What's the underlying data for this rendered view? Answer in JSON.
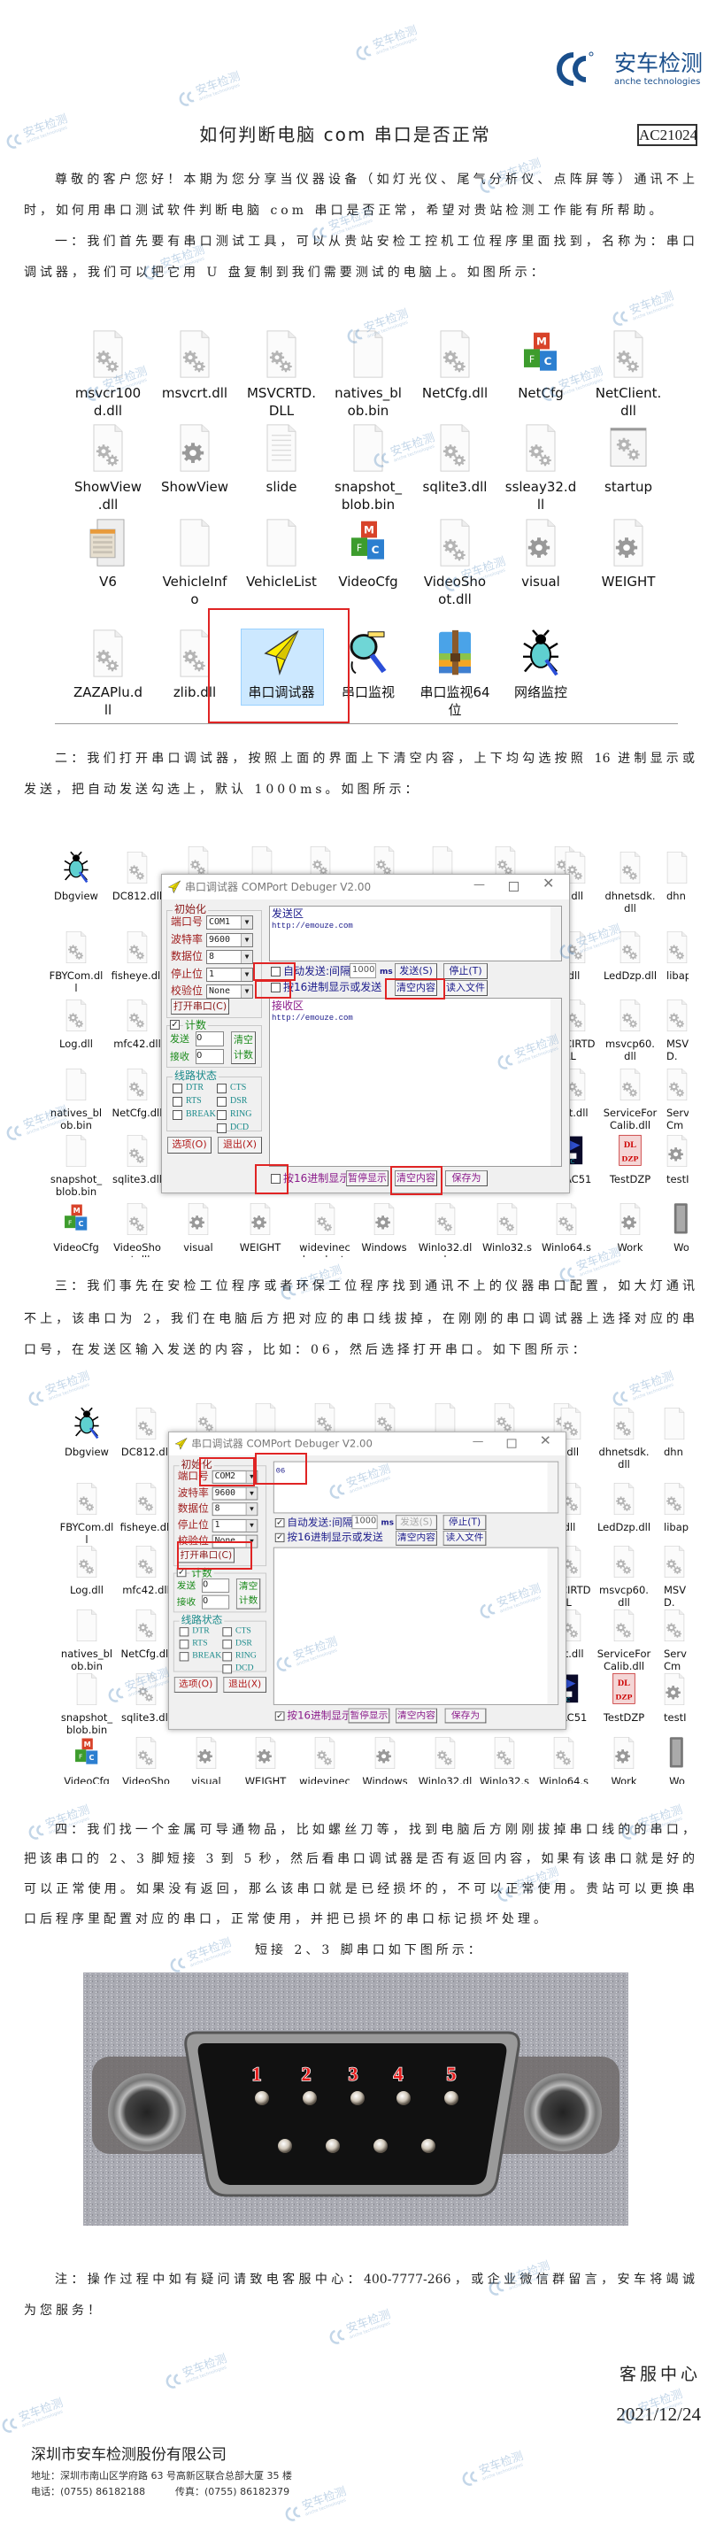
{
  "brand": {
    "name": "安车检测",
    "sub": "anche technologies",
    "color": "#1a4f8c"
  },
  "watermark": {
    "text": "安车检测",
    "sub": "anche technologies"
  },
  "title": "如何判断电脑 com 串口是否正常",
  "doc_code": "AC21024",
  "para1": [
    "尊敬的客户您好！本期为您分享当仪器设备（如灯光仪、尾气分析仪、点阵屏等）通讯不上",
    "时，如何用串口测试软件判断电脑 com 串口是否正常，希望对贵站检测工作能有所帮助。",
    "一：我们首先要有串口测试工具，可以从贵站安检工控机工位程序里面找到，名称为：串口",
    "调试器，我们可以把它用 U 盘复制到我们需要测试的电脑上。如图所示："
  ],
  "para2": [
    "二：我们打开串口调试器，按照上面的界面上下清空内容，上下均勾选按照 16 进制显示或",
    "发送，把自动发送勾选上，默认 1000ms。如图所示："
  ],
  "para3": [
    "三：我们事先在安检工位程序或者环保工位程序找到通讯不上的仪器串口配置，如大灯通讯",
    "不上，该串口为 2，我们在电脑后方把对应的串口线拔掉，在刚刚的串口调试器上选择对应的串",
    "口号，在发送区输入发送的内容，比如：06，然后选择打开串口。如下图所示："
  ],
  "para4": [
    "四：我们找一个金属可导通物品，比如螺丝刀等，找到电脑后方刚刚拔掉串口线的的串口，",
    "把该串口的 2、3 脚短接 3 到 5 秒，然后看串口调试器是否有返回内容，如果有该串口就是好的",
    "可以正常使用。如果没有返回，那么该串口就是已经损坏的，不可以正常使用。贵站可以更换串",
    "口后程序里配置对应的串口，正常使用，并把已损坏的串口标记损坏处理。"
  ],
  "caption": "短接 2、3 脚串口如下图所示：",
  "note": [
    "注：操作过程中如有疑问请致电客服中心：400-7777-266，或企业微信群留言，安车将竭诚",
    "为您服务！"
  ],
  "signature": {
    "dept": "客服中心",
    "date": "2021/12/24"
  },
  "footer": {
    "company": "深圳市安车检测股份有限公司",
    "address": "地址：深圳市南山区学府路 63 号高新区联合总部大厦 35 楼",
    "phone": "电话：(0755) 86182188",
    "fax": "传真：(0755) 86182379"
  },
  "file_grid": [
    {
      "lines": [
        "msvcr100",
        "d.dll"
      ],
      "icon": "gear-doc"
    },
    {
      "lines": [
        "msvcrt.dll"
      ],
      "icon": "gear-doc"
    },
    {
      "lines": [
        "MSVCRTD.",
        "DLL"
      ],
      "icon": "gear-doc"
    },
    {
      "lines": [
        "natives_bl",
        "ob.bin"
      ],
      "icon": "blank-doc"
    },
    {
      "lines": [
        "NetCfg.dll"
      ],
      "icon": "gear-doc"
    },
    {
      "lines": [
        "NetCfg"
      ],
      "icon": "mfc-cubes"
    },
    {
      "lines": [
        "NetClient.",
        "dll"
      ],
      "icon": "gear-doc"
    },
    {
      "lines": [
        "ShowView",
        ".dll"
      ],
      "icon": "gear-doc"
    },
    {
      "lines": [
        "ShowView"
      ],
      "icon": "gear-on-doc"
    },
    {
      "lines": [
        "slide"
      ],
      "icon": "text-doc"
    },
    {
      "lines": [
        "snapshot_",
        "blob.bin"
      ],
      "icon": "blank-doc"
    },
    {
      "lines": [
        "sqlite3.dll"
      ],
      "icon": "gear-doc"
    },
    {
      "lines": [
        "ssleay32.d",
        "ll"
      ],
      "icon": "gear-doc"
    },
    {
      "lines": [
        "startup"
      ],
      "icon": "gear-window"
    },
    {
      "lines": [
        "V6"
      ],
      "icon": "binary-table"
    },
    {
      "lines": [
        "VehicleInf",
        "o"
      ],
      "icon": "blank-doc"
    },
    {
      "lines": [
        "VehicleList"
      ],
      "icon": "blank-doc"
    },
    {
      "lines": [
        "VideoCfg"
      ],
      "icon": "mfc-cubes"
    },
    {
      "lines": [
        "VideoSho",
        "ot.dll"
      ],
      "icon": "gear-doc"
    },
    {
      "lines": [
        "visual"
      ],
      "icon": "gear-on-doc"
    },
    {
      "lines": [
        "WEIGHT"
      ],
      "icon": "gear-on-doc"
    },
    {
      "lines": [
        "ZAZAPlu.d",
        "ll"
      ],
      "icon": "gear-doc"
    },
    {
      "lines": [
        "zlib.dll"
      ],
      "icon": "gear-doc"
    },
    {
      "lines": [
        "串口调试器"
      ],
      "icon": "paper-plane",
      "selected": true
    },
    {
      "lines": [
        "串口监视"
      ],
      "icon": "magnifier"
    },
    {
      "lines": [
        "串口监视64",
        "位"
      ],
      "icon": "archive"
    },
    {
      "lines": [
        "网络监控"
      ],
      "icon": "bug"
    }
  ],
  "desktop": {
    "columns": [
      [
        {
          "lines": [
            "Dbgview"
          ],
          "icon": "bug"
        },
        {
          "lines": [
            "FBYCom.dl",
            "l"
          ],
          "icon": "gear-doc"
        },
        {
          "lines": [
            "Log.dll"
          ],
          "icon": "gear-doc"
        },
        {
          "lines": [
            "natives_bl",
            "ob.bin"
          ],
          "icon": "blank-doc"
        },
        {
          "lines": [
            "snapshot_",
            "blob.bin"
          ],
          "icon": "blank-doc"
        }
      ],
      [
        {
          "lines": [
            "DC812.dll"
          ],
          "icon": "gear-doc"
        },
        {
          "lines": [
            "fisheye.dll"
          ],
          "icon": "gear-doc"
        },
        {
          "lines": [
            "mfc42.dll"
          ],
          "icon": "gear-doc"
        },
        {
          "lines": [
            "NetCfg.dll"
          ],
          "icon": "gear-doc"
        },
        {
          "lines": [
            "sqlite3.dll"
          ],
          "icon": "gear-doc"
        }
      ],
      [
        {
          "lines": [
            "r.dll"
          ],
          "icon": "gear-doc"
        },
        {
          "lines": [
            ".dll"
          ],
          "icon": "gear-doc"
        },
        {
          "lines": [
            "CIRTD",
            "LL"
          ],
          "icon": "gear-doc"
        },
        {
          "lines": [
            "rt.dll"
          ],
          "icon": "gear-doc"
        },
        {
          "lines": [
            "AC51"
          ],
          "icon": "dark-exe"
        }
      ],
      [
        {
          "lines": [
            "dhnetsdk.",
            "dll"
          ],
          "icon": "gear-doc"
        },
        {
          "lines": [
            "LedDzp.dll"
          ],
          "icon": "gear-doc"
        },
        {
          "lines": [
            "msvcp60.",
            "dll"
          ],
          "icon": "gear-doc"
        },
        {
          "lines": [
            "ServiceFor",
            "Calib.dll"
          ],
          "icon": "gear-doc"
        },
        {
          "lines": [
            "TestDZP"
          ],
          "icon": "dl-dzp"
        }
      ],
      [
        {
          "lines": [
            "dhn"
          ],
          "icon": "blank-doc"
        },
        {
          "lines": [
            "libap"
          ],
          "icon": "gear-doc"
        },
        {
          "lines": [
            "MSV",
            "D."
          ],
          "icon": "gear-doc"
        },
        {
          "lines": [
            "Serv",
            "Cm"
          ],
          "icon": "gear-doc"
        },
        {
          "lines": [
            "testI"
          ],
          "icon": "gear-on-doc"
        }
      ]
    ],
    "bottom_row": [
      {
        "lines": [
          "VideoCfg"
        ],
        "icon": "mfc-cubes"
      },
      {
        "lines": [
          "VideoSho",
          "ot.dll"
        ],
        "icon": "gear-doc"
      },
      {
        "lines": [
          "visual"
        ],
        "icon": "gear-on-doc"
      },
      {
        "lines": [
          "WEIGHT"
        ],
        "icon": "gear-on-doc"
      },
      {
        "lines": [
          "widevinec",
          "dmadapte"
        ],
        "icon": "gear-doc"
      },
      {
        "lines": [
          "Windows"
        ],
        "icon": "gear-on-doc"
      },
      {
        "lines": [
          "Winlo32.dl",
          "l"
        ],
        "icon": "gear-doc"
      },
      {
        "lines": [
          "Winlo32.s",
          "ys"
        ],
        "icon": "gear-doc"
      },
      {
        "lines": [
          "Winlo64.s",
          "ys"
        ],
        "icon": "gear-doc"
      },
      {
        "lines": [
          "Work"
        ],
        "icon": "gear-on-doc"
      },
      {
        "lines": [
          "Wo"
        ],
        "icon": "pc-tower"
      }
    ]
  },
  "windows": [
    {
      "title": "串口调试器 COMPort Debuger V2.00",
      "init_label": "初始化",
      "fields": [
        {
          "label": "端口号",
          "value": "COM1"
        },
        {
          "label": "波特率",
          "value": "9600"
        },
        {
          "label": "数据位",
          "value": "8"
        },
        {
          "label": "停止位",
          "value": "1"
        },
        {
          "label": "校验位",
          "value": "None"
        }
      ],
      "open_button": "打开串口(C)",
      "count": {
        "label": "计数",
        "checked": true,
        "send_label": "发送",
        "send_value": "0",
        "recv_label": "接收",
        "recv_value": "0",
        "clear_button": "清空计数"
      },
      "line_status": {
        "label": "线路状态",
        "left": [
          "DTR",
          "RTS",
          "BREAK"
        ],
        "right": [
          "CTS",
          "DSR",
          "RING",
          "DCD"
        ]
      },
      "options_button": "选项(O)",
      "exit_button": "退出(X)",
      "send_area": {
        "label": "发送区",
        "text": "http://emouze.com"
      },
      "auto_send": {
        "label": "自动发送:间隔",
        "checked": false,
        "interval": "1000",
        "unit": "ms"
      },
      "hex_send": {
        "label": "按16进制显示或发送",
        "checked": false
      },
      "send_button": "发送(S)",
      "send_enabled": true,
      "stop_button": "停止(T)",
      "clear_button": "清空内容",
      "load_button": "读入文件",
      "recv_area": {
        "label": "接收区",
        "text": "http://emouze.com"
      },
      "hex_display": {
        "label": "按16进制显示",
        "checked": false
      },
      "pause_button": "暂停显示",
      "clear_recv_button": "清空内容",
      "save_button": "保存为"
    },
    {
      "title": "串口调试器 COMPort Debuger V2.00",
      "init_label": "初始化",
      "fields": [
        {
          "label": "端口号",
          "value": "COM2"
        },
        {
          "label": "波特率",
          "value": "9600"
        },
        {
          "label": "数据位",
          "value": "8"
        },
        {
          "label": "停止位",
          "value": "1"
        },
        {
          "label": "校验位",
          "value": "None"
        }
      ],
      "open_button": "打开串口(C)",
      "count": {
        "label": "计数",
        "checked": true,
        "send_label": "发送",
        "send_value": "0",
        "recv_label": "接收",
        "recv_value": "0",
        "clear_button": "清空计数"
      },
      "line_status": {
        "label": "线路状态",
        "left": [
          "DTR",
          "RTS",
          "BREAK"
        ],
        "right": [
          "CTS",
          "DSR",
          "RING",
          "DCD"
        ]
      },
      "options_button": "选项(O)",
      "exit_button": "退出(X)",
      "send_area": {
        "label": "",
        "text": "06"
      },
      "auto_send": {
        "label": "自动发送:间隔",
        "checked": true,
        "interval": "1000",
        "unit": "ms"
      },
      "hex_send": {
        "label": "按16进制显示或发送",
        "checked": true
      },
      "send_button": "发送(S)",
      "send_enabled": false,
      "stop_button": "停止(T)",
      "clear_button": "清空内容",
      "load_button": "读入文件",
      "recv_area": {
        "label": "",
        "text": ""
      },
      "hex_display": {
        "label": "按16进制显示",
        "checked": true
      },
      "pause_button": "暂停显示",
      "clear_recv_button": "清空内容",
      "save_button": "保存为"
    }
  ],
  "connector_pins": [
    "1",
    "2",
    "3",
    "4",
    "5"
  ],
  "colors": {
    "highlight": "#e02424",
    "selection": "#cce8ff",
    "pin_label": "#e51c1c"
  }
}
